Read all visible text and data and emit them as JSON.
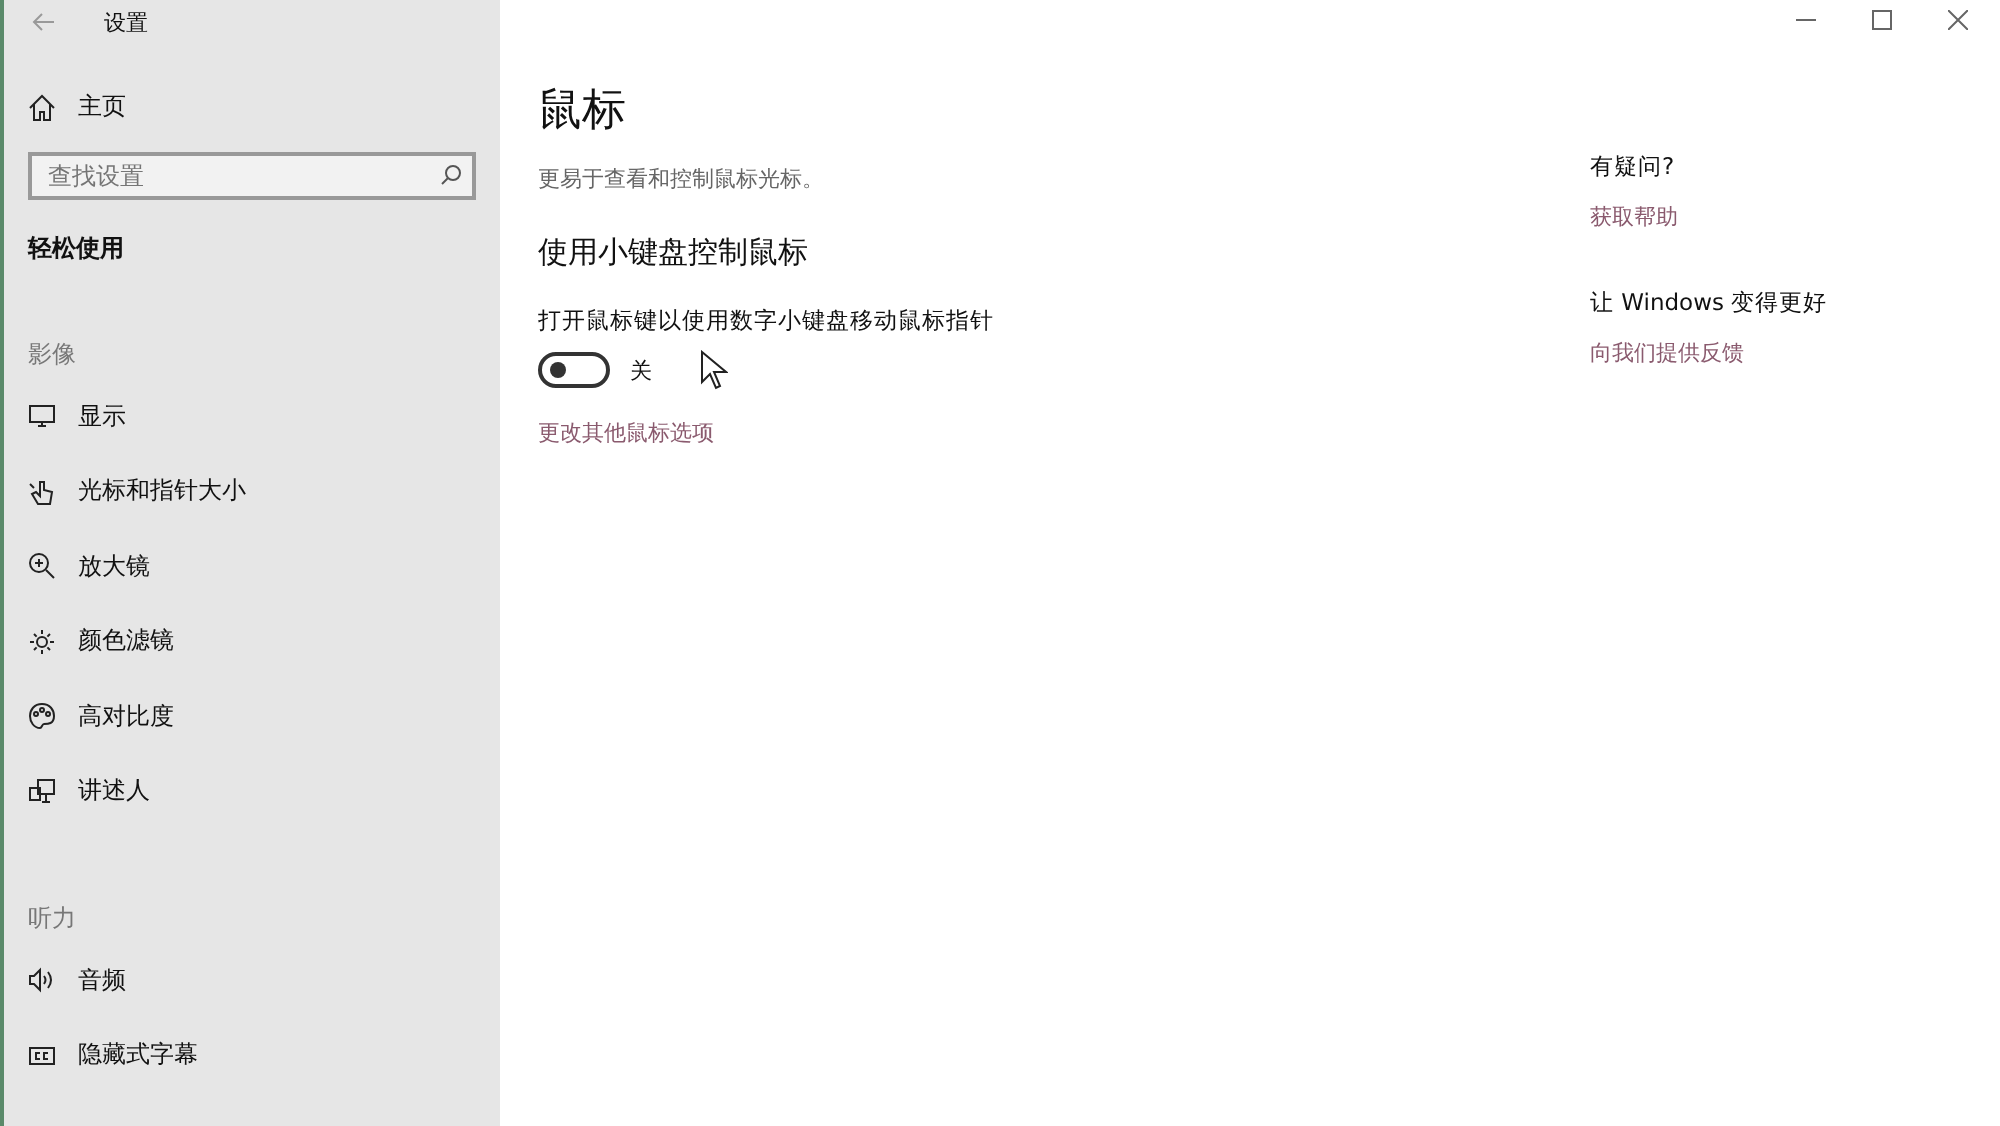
{
  "window": {
    "title": "设置"
  },
  "sidebar": {
    "home": "主页",
    "search": {
      "placeholder": "查找设置"
    },
    "category": "轻松使用",
    "groups": [
      {
        "heading": "影像",
        "items": [
          {
            "label": "显示",
            "selected": false
          },
          {
            "label": "光标和指针大小",
            "selected": false
          },
          {
            "label": "放大镜",
            "selected": false
          },
          {
            "label": "颜色滤镜",
            "selected": false
          },
          {
            "label": "高对比度",
            "selected": false
          },
          {
            "label": "讲述人",
            "selected": false
          }
        ]
      },
      {
        "heading": "听力",
        "items": [
          {
            "label": "音频",
            "selected": false
          },
          {
            "label": "隐藏式字幕",
            "selected": false
          }
        ]
      }
    ]
  },
  "page": {
    "title": "鼠标",
    "subtitle": "更易于查看和控制鼠标光标。",
    "section": "使用小键盘控制鼠标",
    "setting": {
      "label": "打开鼠标键以使用数字小键盘移动鼠标指针",
      "on": false,
      "state_text": "关"
    },
    "link": "更改其他鼠标选项"
  },
  "aside": [
    {
      "heading": "有疑问?",
      "link": "获取帮助"
    },
    {
      "heading": "让 Windows 变得更好",
      "link": "向我们提供反馈"
    }
  ]
}
